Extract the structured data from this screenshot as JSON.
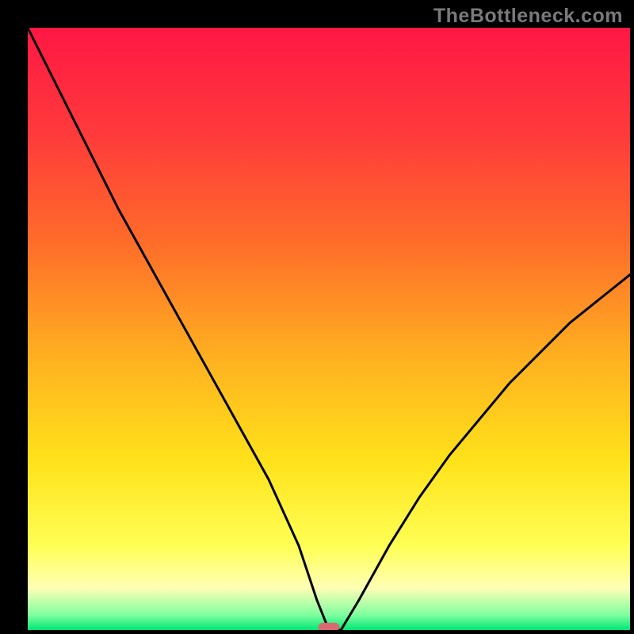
{
  "watermark": "TheBottleneck.com",
  "chart_data": {
    "type": "line",
    "title": "",
    "xlabel": "",
    "ylabel": "",
    "xlim": [
      0,
      100
    ],
    "ylim": [
      0,
      100
    ],
    "background_gradient": {
      "direction": "vertical",
      "stops": [
        {
          "offset": 0.0,
          "color": "#ff1744"
        },
        {
          "offset": 0.18,
          "color": "#ff3b3b"
        },
        {
          "offset": 0.35,
          "color": "#ff6a2a"
        },
        {
          "offset": 0.55,
          "color": "#ffb120"
        },
        {
          "offset": 0.72,
          "color": "#ffe21a"
        },
        {
          "offset": 0.86,
          "color": "#ffff55"
        },
        {
          "offset": 0.93,
          "color": "#ffffb5"
        },
        {
          "offset": 0.975,
          "color": "#7fff9f"
        },
        {
          "offset": 1.0,
          "color": "#00e676"
        }
      ]
    },
    "series": [
      {
        "name": "bottleneck-curve",
        "color": "#000000",
        "x": [
          0,
          5,
          10,
          15,
          20,
          25,
          30,
          35,
          40,
          45,
          48,
          50,
          52,
          55,
          60,
          65,
          70,
          75,
          80,
          85,
          90,
          95,
          100
        ],
        "y": [
          100,
          90,
          80,
          70,
          61,
          52,
          43,
          34,
          25,
          14,
          5,
          0,
          0,
          5,
          14,
          22,
          29,
          35,
          41,
          46,
          51,
          55,
          59
        ]
      }
    ],
    "marker": {
      "name": "optimal-point",
      "x": 50,
      "y": 0.5,
      "width": 3.5,
      "height": 1.4,
      "color": "#d96a6f"
    }
  }
}
